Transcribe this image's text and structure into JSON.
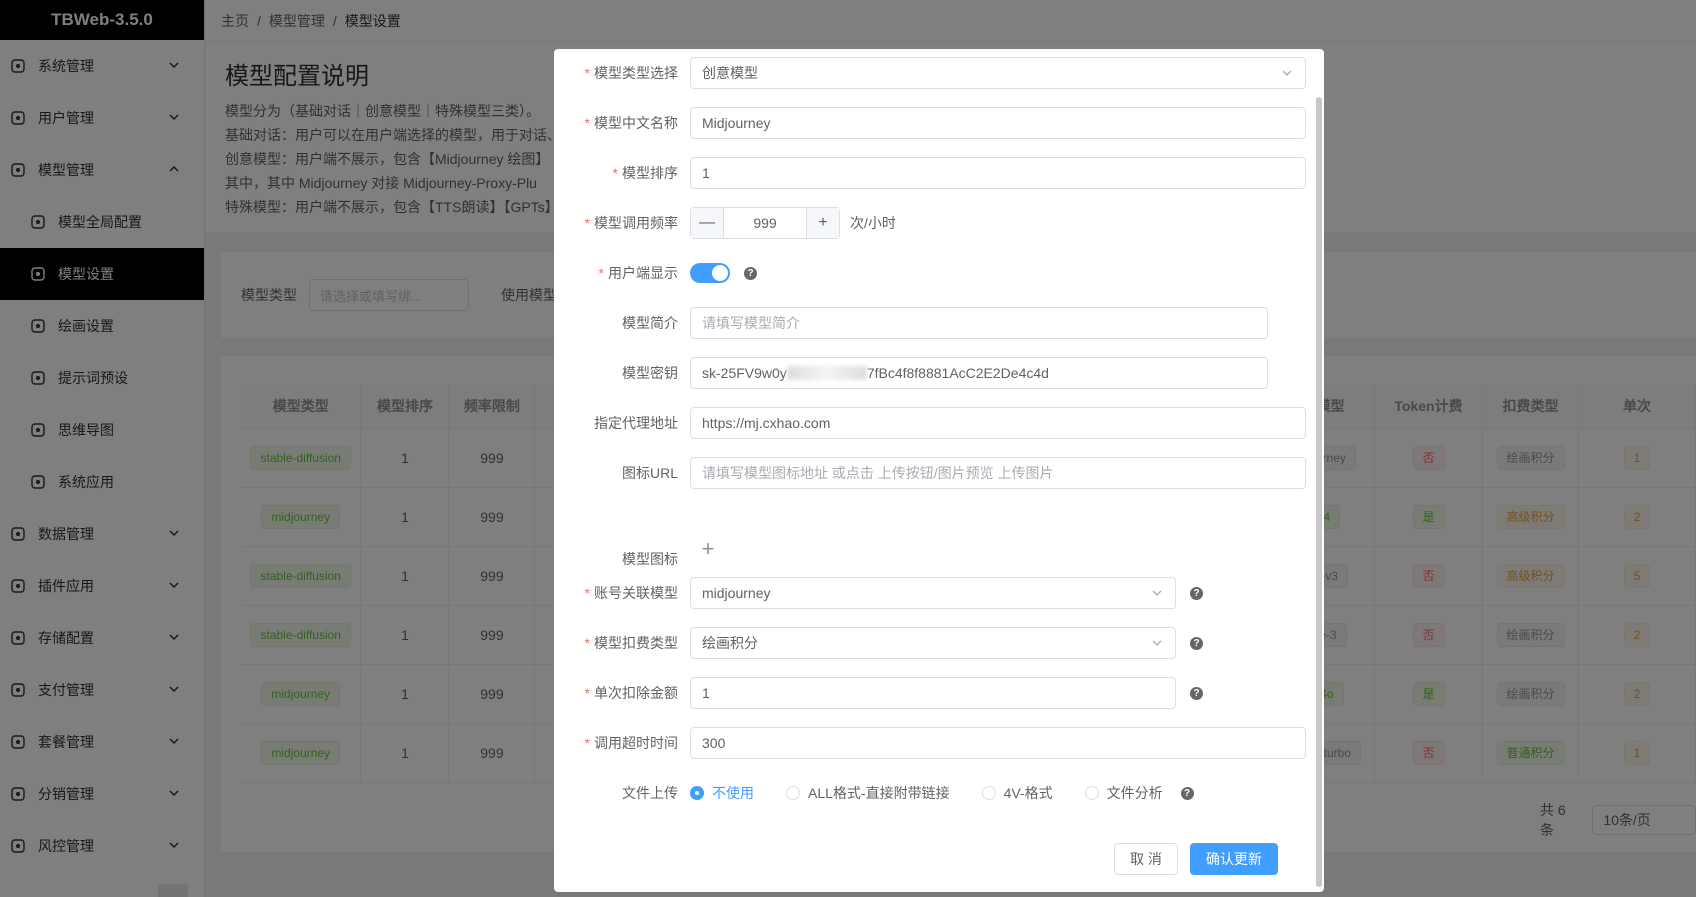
{
  "app": {
    "title": "TBWeb-3.5.0"
  },
  "sidebar": {
    "items": [
      {
        "label": "系统管理",
        "icon": "system-icon"
      },
      {
        "label": "用户管理",
        "icon": "user-icon"
      },
      {
        "label": "模型管理",
        "icon": "model-icon",
        "expanded": true
      },
      {
        "label": "模型全局配置",
        "icon": "cpu-icon",
        "sub": true
      },
      {
        "label": "模型设置",
        "icon": "openai-icon",
        "sub": true,
        "active": true
      },
      {
        "label": "绘画设置",
        "icon": "paint-icon",
        "sub": true
      },
      {
        "label": "提示词预设",
        "icon": "tag-icon",
        "sub": true
      },
      {
        "label": "思维导图",
        "icon": "mindmap-icon",
        "sub": true
      },
      {
        "label": "系统应用",
        "icon": "app-icon",
        "sub": true
      },
      {
        "label": "数据管理",
        "icon": "database-icon"
      },
      {
        "label": "插件应用",
        "icon": "plugin-icon"
      },
      {
        "label": "存储配置",
        "icon": "storage-icon"
      },
      {
        "label": "支付管理",
        "icon": "payment-icon"
      },
      {
        "label": "套餐管理",
        "icon": "package-icon"
      },
      {
        "label": "分销管理",
        "icon": "cart-icon"
      },
      {
        "label": "风控管理",
        "icon": "risk-icon"
      }
    ]
  },
  "breadcrumb": {
    "home": "主页",
    "sep": "/",
    "parent": "模型管理",
    "current": "模型设置"
  },
  "description": {
    "title": "模型配置说明",
    "lines": [
      "模型分为（基础对话｜创意模型｜特殊模型三类）。",
      "基础对话：用户可以在用户端选择的模型，用于对话、",
      "创意模型：用户端不展示，包含【Midjourney 绘图】",
      "其中，其中 Midjourney 对接 Midjourney-Proxy-Plu",
      "特殊模型：用户端不展示，包含【TTS朗读】【GPTs】"
    ]
  },
  "filter": {
    "type_label": "模型类型",
    "type_placeholder": "请选择或填写绑...",
    "use_label": "使用模型"
  },
  "table": {
    "left_headers": [
      "模型类型",
      "模型排序",
      "频率限制"
    ],
    "right_headers": [
      "绑定模型",
      "Token计费",
      "扣费类型",
      "单次"
    ],
    "rows": [
      {
        "type": "stable-diffusion",
        "order": "1",
        "limit": "999",
        "bind": "midjourney",
        "token": "否",
        "charge": "绘画积分",
        "single": "1"
      },
      {
        "type": "midjourney",
        "order": "1",
        "limit": "999",
        "bind": "gpt-4",
        "token": "是",
        "charge": "高级积分",
        "single": "2"
      },
      {
        "type": "stable-diffusion",
        "order": "1",
        "limit": "999",
        "bind": "suno-v3",
        "token": "否",
        "charge": "高级积分",
        "single": "5"
      },
      {
        "type": "stable-diffusion",
        "order": "1",
        "limit": "999",
        "bind": "dall-e-3",
        "token": "否",
        "charge": "绘画积分",
        "single": "2"
      },
      {
        "type": "midjourney",
        "order": "1",
        "limit": "999",
        "bind": "gpt-4o",
        "token": "是",
        "charge": "绘画积分",
        "single": "2"
      },
      {
        "type": "midjourney",
        "order": "1",
        "limit": "999",
        "bind": "gpt-3.5-turbo",
        "token": "否",
        "charge": "普通积分",
        "single": "1"
      }
    ]
  },
  "pager": {
    "total": "共 6 条",
    "page_size": "10条/页"
  },
  "form": {
    "model_type": {
      "label": "模型类型选择",
      "value": "创意模型"
    },
    "cn_name": {
      "label": "模型中文名称",
      "value": "Midjourney"
    },
    "order": {
      "label": "模型排序",
      "value": "1"
    },
    "frequency": {
      "label": "模型调用频率",
      "value": "999",
      "unit": "次/小时",
      "minus": "—",
      "plus": "+"
    },
    "client_show": {
      "label": "用户端显示",
      "on": true
    },
    "intro": {
      "label": "模型简介",
      "placeholder": "请填写模型简介"
    },
    "key": {
      "label": "模型密钥",
      "value_prefix": "sk-25FV9w0y",
      "value_suffix": "7fBc4f8f8881AcC2E2De4c4d"
    },
    "proxy": {
      "label": "指定代理地址",
      "value": "https://mj.cxhao.com"
    },
    "icon_url": {
      "label": "图标URL",
      "placeholder": "请填写模型图标地址 或点击 上传按钮/图片预览 上传图片"
    },
    "icon": {
      "label": "模型图标",
      "plus": "+"
    },
    "account_model": {
      "label": "账号关联模型",
      "value": "midjourney"
    },
    "charge_type": {
      "label": "模型扣费类型",
      "value": "绘画积分"
    },
    "single_charge": {
      "label": "单次扣除金额",
      "value": "1"
    },
    "timeout": {
      "label": "调用超时时间",
      "value": "300"
    },
    "upload": {
      "label": "文件上传",
      "options": [
        "不使用",
        "ALL格式-直接附带链接",
        "4V-格式",
        "文件分析"
      ],
      "selected": 0
    }
  },
  "buttons": {
    "cancel": "取 消",
    "confirm": "确认更新"
  },
  "colors": {
    "primary": "#409eff",
    "required": "#f56c6c",
    "sidebar_active": "#000000"
  }
}
